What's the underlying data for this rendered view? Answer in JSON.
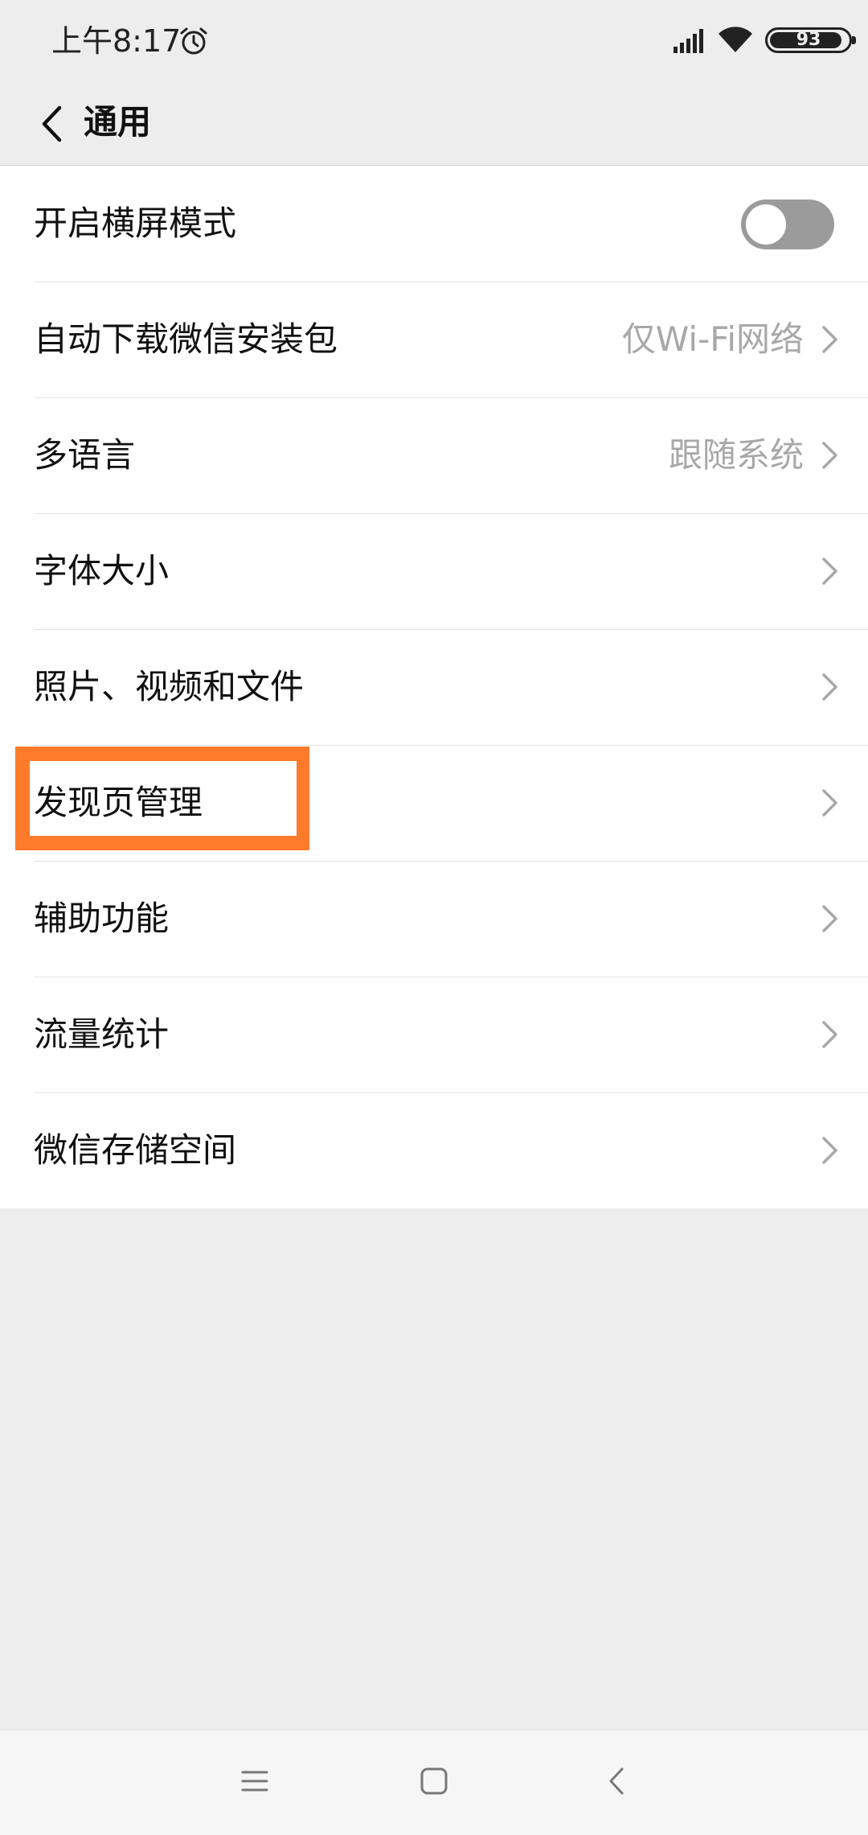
{
  "status_bar": {
    "time": "上午8:17",
    "battery_level": "93",
    "icons": [
      "alarm-icon",
      "signal-icon",
      "wifi-icon",
      "battery-icon"
    ]
  },
  "header": {
    "title": "通用",
    "back_icon": "chevron-left-icon"
  },
  "settings": {
    "landscape": {
      "label": "开启横屏模式",
      "toggle_on": false
    },
    "auto_download": {
      "label": "自动下载微信安装包",
      "value": "仅Wi-Fi网络"
    },
    "language": {
      "label": "多语言",
      "value": "跟随系统"
    },
    "font_size": {
      "label": "字体大小"
    },
    "media": {
      "label": "照片、视频和文件"
    },
    "discover": {
      "label": "发现页管理"
    },
    "accessibility": {
      "label": "辅助功能"
    },
    "data_usage": {
      "label": "流量统计"
    },
    "storage": {
      "label": "微信存储空间"
    }
  },
  "bottom_nav": {
    "icons": [
      "menu-icon",
      "home-icon",
      "back-icon"
    ]
  },
  "colors": {
    "background": "#ededed",
    "highlight": "#ff7b2c",
    "toggle_off": "#9b9b9b",
    "value_text": "#a8a8a8"
  }
}
